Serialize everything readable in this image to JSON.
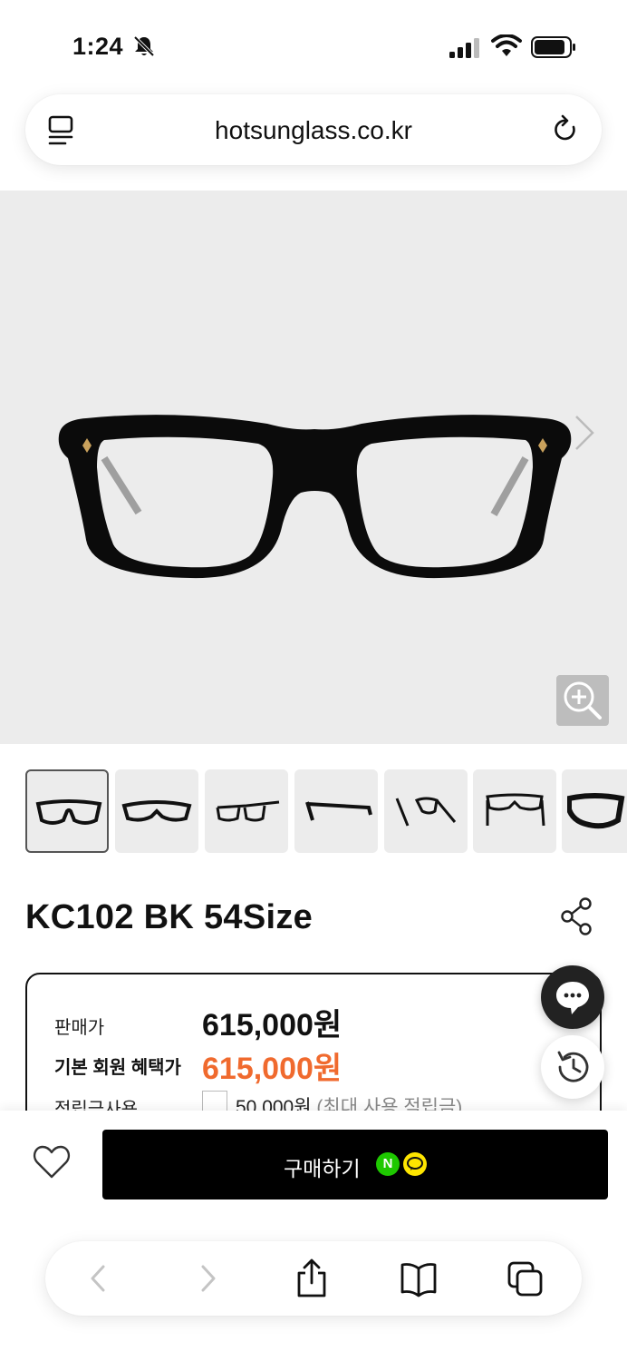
{
  "status_bar": {
    "time": "1:24",
    "icons": [
      "bell-slash-icon",
      "signal-icon",
      "wifi-icon",
      "battery-icon"
    ]
  },
  "address_bar": {
    "url": "hotsunglass.co.kr",
    "icons": [
      "tab-list-icon",
      "reload-icon"
    ]
  },
  "gallery": {
    "thumbnail_count": 7,
    "active_thumbnail": 1,
    "icons": [
      "chevron-right-icon",
      "zoom-in-icon"
    ]
  },
  "product": {
    "title": "KC102 BK 54Size",
    "price_label": "판매가",
    "price_value": "615,000원",
    "member_label": "기본 회원 혜택가",
    "member_value": "615,000원",
    "points_label": "적립금사용",
    "points_value": "50,000원",
    "points_note": "(최대 사용 적립금)"
  },
  "purchase": {
    "buy_label": "구매하기",
    "npay_label": "N"
  },
  "colors": {
    "accent_orange": "#f06a2e",
    "buy_button": "#000000",
    "hero_bg": "#ececec",
    "npay_green": "#1ec800",
    "kakao_yellow": "#fee500"
  }
}
